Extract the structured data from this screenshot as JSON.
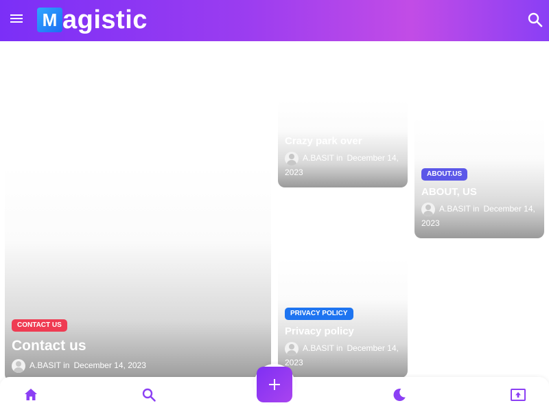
{
  "header": {
    "logo_letter": "M",
    "logo_rest": "agistic",
    "menu_icon": "hamburger-menu-icon",
    "search_icon": "search-icon"
  },
  "posts": [
    {
      "category": "CONTACT US",
      "title": "Contact us",
      "author": "A.BASIT",
      "in": "in",
      "date": "December 14, 2023",
      "badge_color": "#ef3b52"
    },
    {
      "category": "",
      "title": "Crazy park over",
      "author": "A.BASIT",
      "in": "in",
      "date": "December 14, 2023"
    },
    {
      "category": "ABOUT.US",
      "title": "ABOUT, US",
      "author": "A.BASIT",
      "in": "in",
      "date": "December 14, 2023",
      "badge_color": "#5b57e8"
    },
    {
      "category": "PRIVACY POLICY",
      "title": "Privacy policy",
      "author": "A.BASIT",
      "in": "in",
      "date": "December 14, 2023",
      "badge_color": "#1e74f0"
    }
  ],
  "bottom_nav": {
    "items": [
      "home-icon",
      "search-icon",
      "plus-icon",
      "dark-mode-icon",
      "scroll-top-icon"
    ],
    "accent_color": "#8b3ff4"
  }
}
